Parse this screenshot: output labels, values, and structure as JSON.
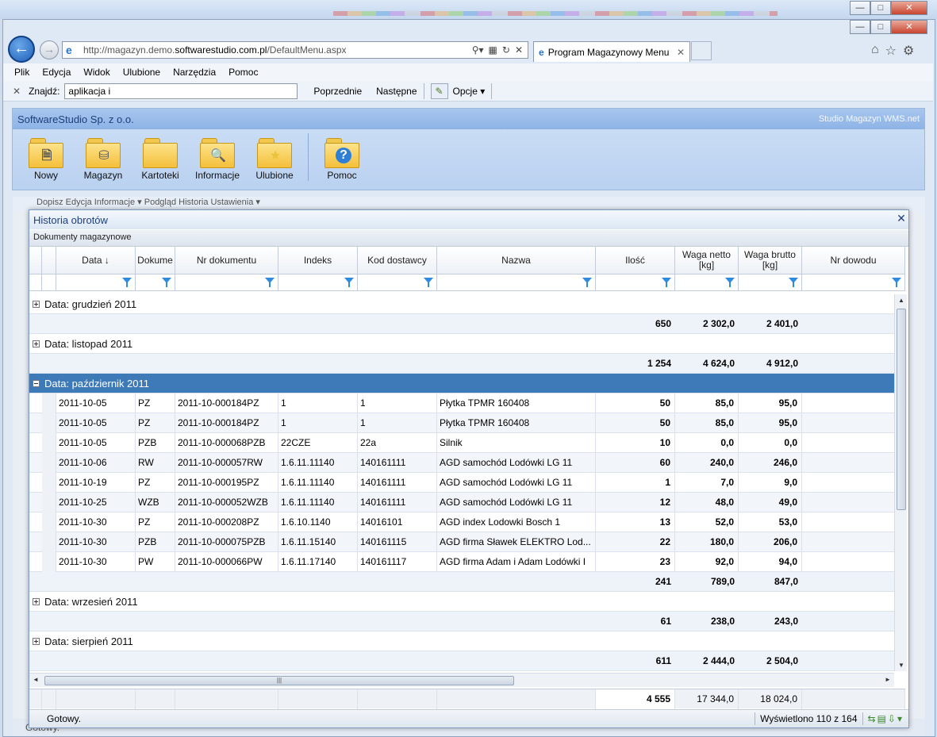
{
  "browser": {
    "url_prefix": "http://magazyn.demo.",
    "url_host": "softwarestudio.com.pl",
    "url_path": "/DefaultMenu.aspx",
    "tab_title": "Program Magazynowy Menu",
    "menu": [
      "Plik",
      "Edycja",
      "Widok",
      "Ulubione",
      "Narzędzia",
      "Pomoc"
    ],
    "find": {
      "label": "Znajdź:",
      "value": "aplikacja i",
      "prev": "Poprzednie",
      "next": "Następne",
      "options": "Opcje"
    }
  },
  "app": {
    "company": "SoftwareStudio Sp. z o.o.",
    "product": "Studio Magazyn WMS.net",
    "ribbon": [
      {
        "label": "Nowy",
        "icon": "document-folder-icon"
      },
      {
        "label": "Magazyn",
        "icon": "database-folder-icon"
      },
      {
        "label": "Kartoteki",
        "icon": "folder-icon"
      },
      {
        "label": "Informacje",
        "icon": "search-folder-icon"
      },
      {
        "label": "Ulubione",
        "icon": "star-folder-icon"
      },
      {
        "label": "Pomoc",
        "icon": "help-folder-icon"
      }
    ],
    "behind_toolbar": "Dopisz   Edycja   Informacje ▾   Podgląd   Historia   Ustawienia ▾",
    "behind_status": "Gotowy."
  },
  "dialog": {
    "title": "Historia obrotów",
    "grid_caption": "Dokumenty magazynowe",
    "columns": [
      "Data ↓",
      "Dokume",
      "Nr dokumentu",
      "Indeks",
      "Kod dostawcy",
      "Nazwa",
      "Ilość",
      "Waga netto [kg]",
      "Waga brutto [kg]",
      "Nr dowodu"
    ],
    "groups": [
      {
        "label": "Data: grudzień 2011",
        "expanded": false,
        "qty": "650",
        "net": "2 302,0",
        "gross": "2 401,0"
      },
      {
        "label": "Data: listopad 2011",
        "expanded": false,
        "qty": "1 254",
        "net": "4 624,0",
        "gross": "4 912,0"
      },
      {
        "label": "Data: październik 2011",
        "expanded": true,
        "qty": "241",
        "net": "789,0",
        "gross": "847,0",
        "rows": [
          {
            "date": "2011-10-05",
            "type": "PZ",
            "doc": "2011-10-000184PZ",
            "index": "1",
            "supplier": "1",
            "name": "Płytka TPMR 160408",
            "qty": "50",
            "net": "85,0",
            "gross": "95,0"
          },
          {
            "date": "2011-10-05",
            "type": "PZ",
            "doc": "2011-10-000184PZ",
            "index": "1",
            "supplier": "1",
            "name": "Płytka TPMR 160408",
            "qty": "50",
            "net": "85,0",
            "gross": "95,0"
          },
          {
            "date": "2011-10-05",
            "type": "PZB",
            "doc": "2011-10-000068PZB",
            "index": "22CZE",
            "supplier": "22a",
            "name": "Silnik",
            "qty": "10",
            "net": "0,0",
            "gross": "0,0"
          },
          {
            "date": "2011-10-06",
            "type": "RW",
            "doc": "2011-10-000057RW",
            "index": "1.6.11.11140",
            "supplier": "140161111",
            "name": "AGD samochód Lodówki LG 11",
            "qty": "60",
            "net": "240,0",
            "gross": "246,0"
          },
          {
            "date": "2011-10-19",
            "type": "PZ",
            "doc": "2011-10-000195PZ",
            "index": "1.6.11.11140",
            "supplier": "140161111",
            "name": "AGD samochód Lodówki LG 11",
            "qty": "1",
            "net": "7,0",
            "gross": "9,0"
          },
          {
            "date": "2011-10-25",
            "type": "WZB",
            "doc": "2011-10-000052WZB",
            "index": "1.6.11.11140",
            "supplier": "140161111",
            "name": "AGD samochód Lodówki LG 11",
            "qty": "12",
            "net": "48,0",
            "gross": "49,0"
          },
          {
            "date": "2011-10-30",
            "type": "PZ",
            "doc": "2011-10-000208PZ",
            "index": "1.6.10.1140",
            "supplier": "14016101",
            "name": "AGD index Lodowki Bosch 1",
            "qty": "13",
            "net": "52,0",
            "gross": "53,0"
          },
          {
            "date": "2011-10-30",
            "type": "PZB",
            "doc": "2011-10-000075PZB",
            "index": "1.6.11.15140",
            "supplier": "140161115",
            "name": "AGD firma Sławek ELEKTRO Lod...",
            "qty": "22",
            "net": "180,0",
            "gross": "206,0"
          },
          {
            "date": "2011-10-30",
            "type": "PW",
            "doc": "2011-10-000066PW",
            "index": "1.6.11.17140",
            "supplier": "140161117",
            "name": "AGD firma Adam i Adam Lodówki I",
            "qty": "23",
            "net": "92,0",
            "gross": "94,0"
          }
        ]
      },
      {
        "label": "Data: wrzesień 2011",
        "expanded": false,
        "qty": "61",
        "net": "238,0",
        "gross": "243,0"
      },
      {
        "label": "Data: sierpień 2011",
        "expanded": false,
        "qty": "611",
        "net": "2 444,0",
        "gross": "2 504,0"
      }
    ],
    "totals": {
      "qty": "4 555",
      "net": "17 344,0",
      "gross": "18 024,0"
    },
    "status": "Gotowy.",
    "shown": "Wyświetlono 110 z 164"
  }
}
